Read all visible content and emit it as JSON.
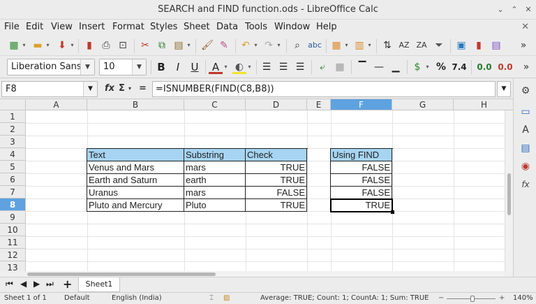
{
  "window": {
    "title": "SEARCH and FIND function.ods - LibreOffice Calc"
  },
  "menu": {
    "items": [
      "File",
      "Edit",
      "View",
      "Insert",
      "Format",
      "Styles",
      "Sheet",
      "Data",
      "Tools",
      "Window",
      "Help"
    ]
  },
  "toolbar": {
    "font_name": "Liberation Sans",
    "font_size": "10",
    "bold": "B",
    "italic": "I",
    "underline": "U",
    "currency": "$",
    "percent": "%",
    "number": "7.4",
    "decimal_add": "0.0",
    "decimal_del": "0.0"
  },
  "formula_bar": {
    "cell_ref": "F8",
    "fx": "fx",
    "sum": "Σ",
    "equals": "=",
    "formula": "=ISNUMBER(FIND(C8,B8))"
  },
  "columns": [
    "A",
    "B",
    "C",
    "D",
    "E",
    "F",
    "G",
    "H"
  ],
  "rows": [
    "1",
    "2",
    "3",
    "4",
    "5",
    "6",
    "7",
    "8",
    "9",
    "10",
    "11",
    "12",
    "13"
  ],
  "table_main": {
    "headers": [
      "Text",
      "Substring",
      "Check"
    ],
    "rows": [
      [
        "Venus and Mars",
        "mars",
        "TRUE"
      ],
      [
        "Earth and Saturn",
        "earth",
        "TRUE"
      ],
      [
        "Uranus",
        "mars",
        "FALSE"
      ],
      [
        "Pluto and Mercury",
        "Pluto",
        "TRUE"
      ]
    ]
  },
  "table_find": {
    "header": "Using FIND",
    "values": [
      "FALSE",
      "FALSE",
      "FALSE",
      "TRUE"
    ]
  },
  "sheet_tabs": [
    "Sheet1"
  ],
  "status": {
    "sheet": "Sheet 1 of 1",
    "style": "Default",
    "language": "English (India)",
    "summary": "Average: TRUE; Count: 1; CountA: 1; Sum: TRUE",
    "zoom": "140%"
  },
  "colors": {
    "header_fill": "#a6d4f2",
    "selection": "#5ea2e0"
  }
}
